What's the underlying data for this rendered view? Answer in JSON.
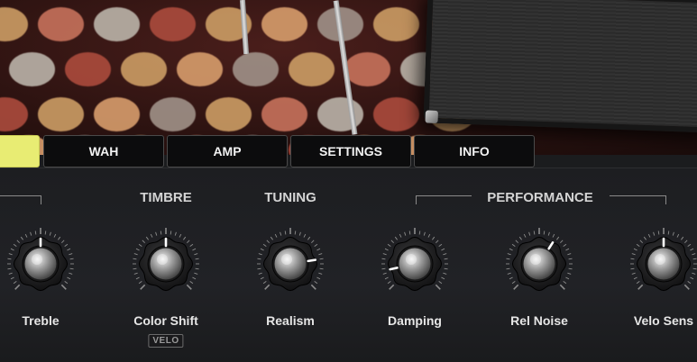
{
  "tabs": [
    {
      "label": "",
      "active": true
    },
    {
      "label": "WAH",
      "active": false
    },
    {
      "label": "AMP",
      "active": false
    },
    {
      "label": "SETTINGS",
      "active": false
    },
    {
      "label": "INFO",
      "active": false
    }
  ],
  "sections": {
    "timbre": "TIMBRE",
    "tuning": "TUNING",
    "performance": "PERFORMANCE"
  },
  "knobs": [
    {
      "label": "Treble",
      "value": 0.5
    },
    {
      "label": "Color Shift",
      "value": 0.5
    },
    {
      "label": "Realism",
      "value": 0.8
    },
    {
      "label": "Damping",
      "value": 0.12
    },
    {
      "label": "Rel Noise",
      "value": 0.62
    },
    {
      "label": "Velo Sens",
      "value": 0.5
    }
  ],
  "velo_badge": "VELO",
  "colors": {
    "accent_tab": "#e8ec73",
    "panel_bg": "#1e1f22",
    "pointer": "#ffffff"
  }
}
